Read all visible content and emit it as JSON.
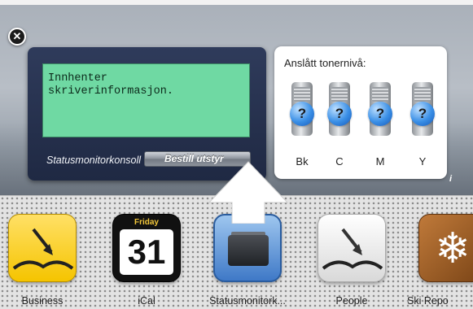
{
  "widget": {
    "close_symbol": "✕",
    "lcd_text": "Innhenter\nskriverinformasjon.",
    "status_label": "Statusmonitorkonsoll",
    "order_button": "Bestill utstyr",
    "info_symbol": "i"
  },
  "toner": {
    "title": "Anslått tonernivå:",
    "unknown_symbol": "?",
    "cartridges": [
      {
        "label": "Bk",
        "level": "unknown"
      },
      {
        "label": "C",
        "level": "unknown"
      },
      {
        "label": "M",
        "level": "unknown"
      },
      {
        "label": "Y",
        "level": "unknown"
      }
    ]
  },
  "dock": {
    "apps": [
      {
        "label": "Business",
        "icon": "ledger-arrow-icon"
      },
      {
        "label": "iCal",
        "icon": "calendar-icon",
        "day": "Friday",
        "date": "31"
      },
      {
        "label": "Statusmonitork...",
        "icon": "printer-icon"
      },
      {
        "label": "People",
        "icon": "ledger-arrow-icon"
      },
      {
        "label": "Ski Repo",
        "icon": "snowflake-icon",
        "glyph": "❄"
      }
    ]
  },
  "colors": {
    "lcd": "#6fd9a3",
    "widget_bg": "#2f3b5b",
    "toner_bubble": "#3a8fe6"
  }
}
